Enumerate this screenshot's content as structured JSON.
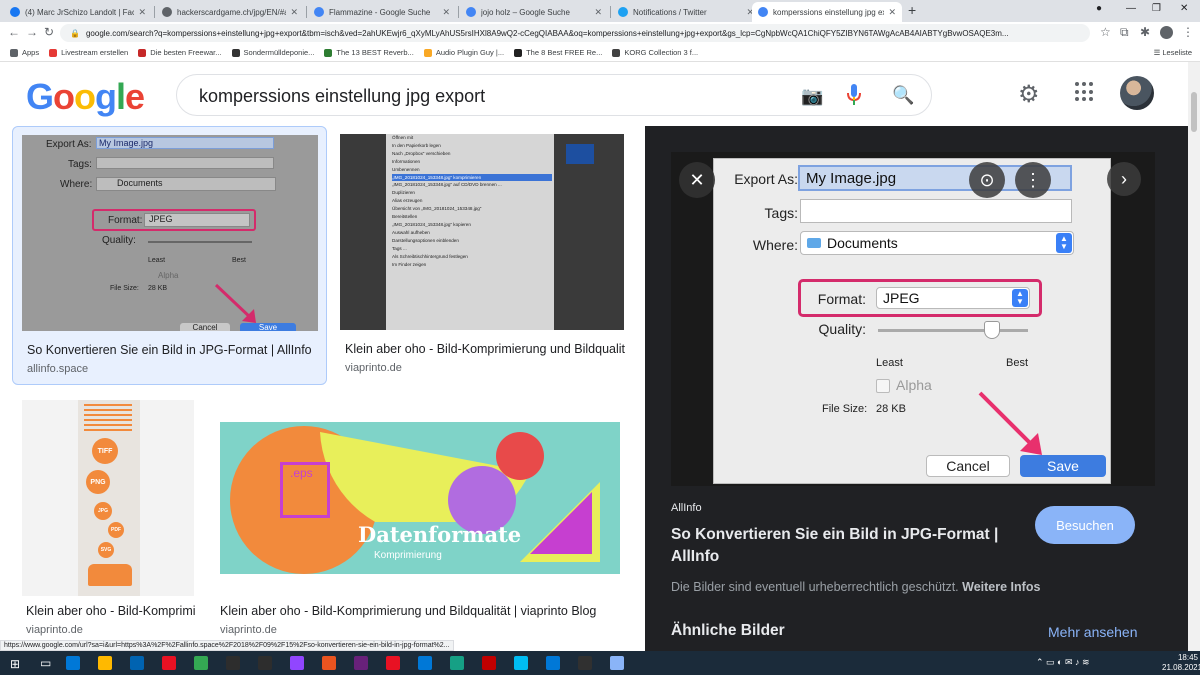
{
  "browser": {
    "tabs": [
      {
        "title": "(4) Marc JrSchizo Landolt | Facebook",
        "color": "#1877f2"
      },
      {
        "title": "hackerscardgame.ch/jpg/EN/#a1",
        "color": "#5f6368"
      },
      {
        "title": "Flammazine - Google Suche",
        "color": "#4285f4"
      },
      {
        "title": "jojo holz – Google Suche",
        "color": "#4285f4"
      },
      {
        "title": "Notifications / Twitter",
        "color": "#1da1f2"
      },
      {
        "title": "komperssions einstellung jpg export",
        "color": "#4285f4"
      }
    ],
    "url": "google.com/search?q=komperssions+einstellung+jpg+export&tbm=isch&ved=2ahUKEwjr6_qXyMLyAhUS5rsIHXl8A9wQ2-cCegQIABAA&oq=komperssions+einstellung+jpg+export&gs_lcp=CgNpbWcQA1ChiQFY5ZIBYN6TAWgAcAB4AIABTYgBvwOSAQE3m...",
    "bookmarks": [
      {
        "label": "Apps",
        "color": "#5f6368"
      },
      {
        "label": "Livestream erstellen",
        "color": "#e53935"
      },
      {
        "label": "Die besten Freewar...",
        "color": "#c62828"
      },
      {
        "label": "Sondermülldeponie...",
        "color": "#333333"
      },
      {
        "label": "The 13 BEST Reverb...",
        "color": "#2e7d32"
      },
      {
        "label": "Audio Plugin Guy |...",
        "color": "#f9a825"
      },
      {
        "label": "The 8 Best FREE Re...",
        "color": "#212121"
      },
      {
        "label": "KORG Collection 3 f...",
        "color": "#424242"
      }
    ],
    "reading_list": "Leseliste"
  },
  "google": {
    "logo": [
      "G",
      "o",
      "o",
      "g",
      "l",
      "e"
    ],
    "logo_colors": [
      "#4285f4",
      "#ea4335",
      "#fbbc05",
      "#4285f4",
      "#34a853",
      "#ea4335"
    ],
    "query": "komperssions einstellung jpg export"
  },
  "results": [
    {
      "title": "So Konvertieren Sie ein Bild in JPG-Format | AllInfo",
      "source": "allinfo.space"
    },
    {
      "title": "Klein aber oho - Bild-Komprimierung und Bildqualität | viaprinto Blog",
      "source": "viaprinto.de"
    },
    {
      "title": "Klein aber oho - Bild-Komprimierung und Bildqualität | viaprinto Blog",
      "source": "viaprinto.de"
    },
    {
      "title": "Klein aber oho - Bild-Komprimierung und Bildqualität | viaprinto Blog",
      "source": "viaprinto.de"
    }
  ],
  "thumb_text": {
    "export_as": "Export As:",
    "export_value": "My Image.jpg",
    "tags": "Tags:",
    "where": "Where:",
    "documents": "Documents",
    "format": "Format:",
    "jpeg": "JPEG",
    "quality": "Quality:",
    "least": "Least",
    "best": "Best",
    "alpha": "Alpha",
    "file_size": "File Size:",
    "file_size_value": "28 KB",
    "cancel": "Cancel",
    "save": "Save",
    "menu_items": [
      "Öffnen mit",
      "In den Papierkorb legen",
      "Nach „Dropbox“ verschieben",
      "Informationen",
      "Umbenennen",
      "„IMG_20181024_153348.jpg“ komprimieren",
      "„IMG_20181024_153348.jpg“ auf CD/DVD brennen ...",
      "Duplizieren",
      "Alias erzeugen",
      "Übersicht von „IMG_20181024_153348.jpg“",
      "Bereitstellen",
      "„IMG_20181024_153348.jpg“ kopieren",
      "Auswahl aufheben",
      "Darstellungsoptionen einblenden",
      "Tags ...",
      "Als Schreibtischhintergrund festlegen",
      "Im Finder zeigen"
    ],
    "tiff": "TIFF",
    "png": "PNG",
    "jpg": "JPG",
    "pdf": "PDF",
    "svg": "SVG",
    "eps": ".eps",
    "datenformate": "Datenformate",
    "komprimierung": "Komprimierung"
  },
  "panel": {
    "source": "AllInfo",
    "title": "So Konvertieren Sie ein Bild in JPG-Format | AllInfo",
    "visit": "Besuchen",
    "copyright": "Die Bilder sind eventuell urheberrechtlich geschützt.",
    "more_info": "Weitere Infos",
    "similar": "Ähnliche Bilder",
    "see_more": "Mehr ansehen"
  },
  "status_url": "https://www.google.com/url?sa=i&url=https%3A%2F%2Fallinfo.space%2F2018%2F09%2F15%2Fso-konvertieren-sie-ein-bild-in-jpg-format%2...",
  "taskbar": {
    "time": "18:45",
    "date": "21.08.2021",
    "icon_colors": [
      "#0078d7",
      "#ffb900",
      "#0063b1",
      "#e81123",
      "#34a853",
      "#2d2d2d",
      "#2d2d2d",
      "#9146ff",
      "#e95420",
      "#68217a",
      "#e81123",
      "#0078d7",
      "#16a085",
      "#c00000",
      "#00bcf2",
      "#0078d7",
      "#303030",
      "#8ab4f8"
    ]
  }
}
